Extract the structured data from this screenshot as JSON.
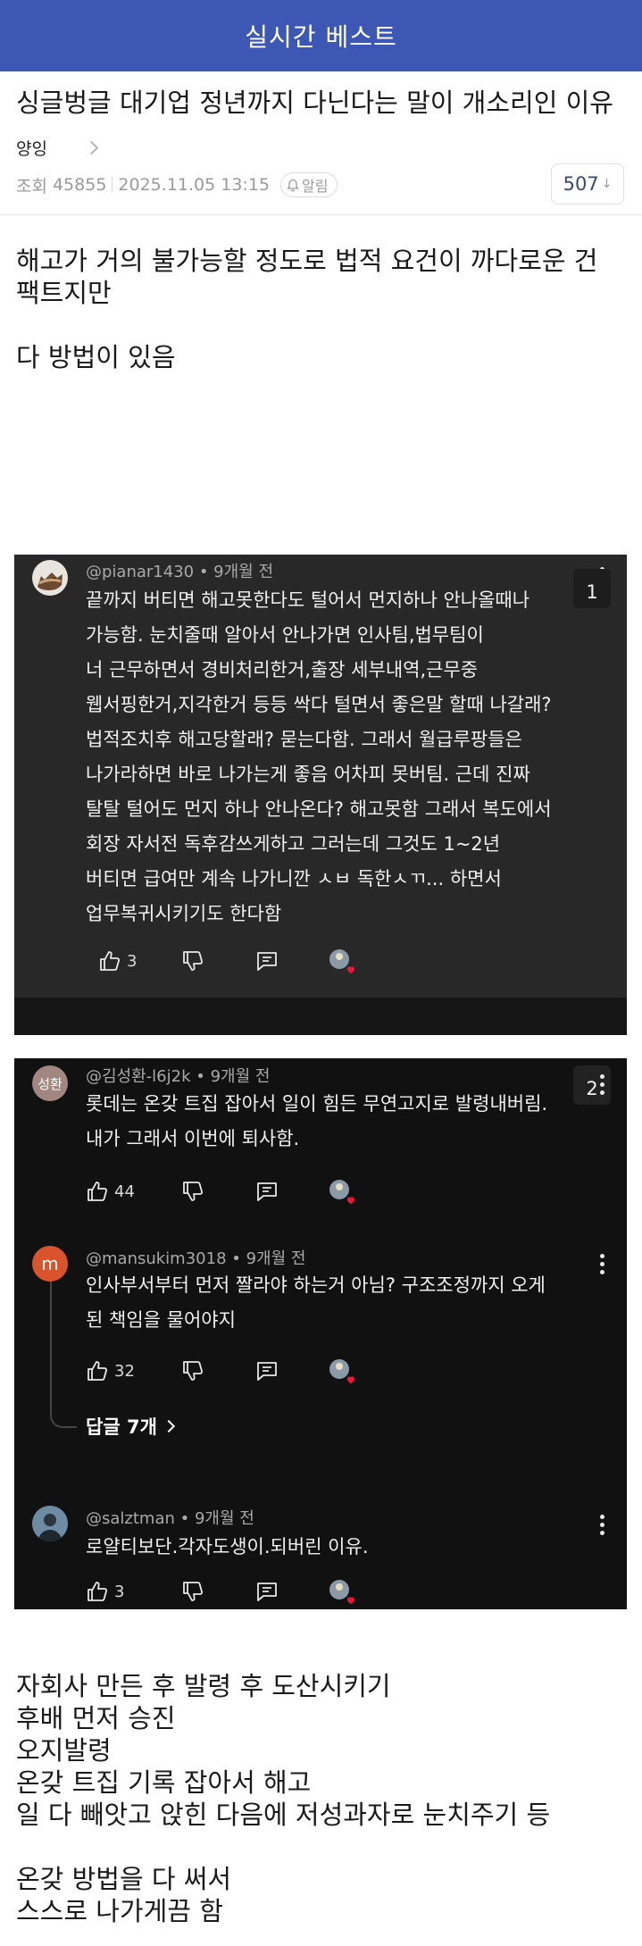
{
  "header": {
    "title": "실시간 베스트"
  },
  "post": {
    "title": "싱글벙글 대기업 정년까지 다닌다는 말이 개소리인 이유",
    "author": "양잉",
    "views_label": "조회",
    "views": "45855",
    "datetime": "2025.11.05 13:15",
    "alarm_label": "알림",
    "comment_count": "507",
    "comment_arrow": "↓",
    "intro_line1": "해고가 거의 불가능할 정도로 법적 요건이 까다로운 건",
    "intro_line2": "팩트지만",
    "intro_line3": "다 방법이 있음",
    "outro_lines": [
      "자회사 만든 후 발령 후 도산시키기",
      "후배 먼저 승진",
      "오지발령",
      "온갖 트집 기록 잡아서 해고",
      "일 다 빼앗고 앉힌 다음에 저성과자로 눈치주기 등"
    ],
    "outro_final1": "온갖 방법을 다 써서",
    "outro_final2": "스스로 나가게끔 함"
  },
  "comment_cards": [
    {
      "rank": "1",
      "comments": [
        {
          "handle": "@pianar1430 • 9개월 전",
          "lines": [
            "끝까지 버티면 해고못한다도 털어서 먼지하나 안나올때나",
            "가능함. 눈치줄때 알아서 안나가면 인사팀,법무팀이",
            "너 근무하면서 경비처리한거,출장 세부내역,근무중",
            "웹서핑한거,지각한거 등등 싹다 털면서 좋은말 할때 나갈래?",
            "법적조치후 해고당할래? 묻는다함. 그래서 월급루팡들은",
            "나가라하면 바로 나가는게 좋음 어차피 못버팀. 근데 진짜",
            "탈탈 털어도 먼지 하나 안나온다? 해고못함 그래서 복도에서",
            "회장 자서전 독후감쓰게하고 그러는데 그것도 1~2년",
            "버티면 급여만 계속 나가니깐 ㅅㅂ 독한ㅅㄲ... 하면서",
            "업무복귀시키기도 한다함"
          ],
          "likes": "3",
          "avatar_icon": "cat-avatar-icon"
        }
      ]
    },
    {
      "rank": "2",
      "comments": [
        {
          "handle": "@김성환-l6j2k • 9개월 전",
          "avatar_text": "성환",
          "lines": [
            "롯데는 온갖 트집 잡아서 일이 힘든 무연고지로 발령내버림.",
            "내가 그래서 이번에 퇴사함."
          ],
          "likes": "44"
        },
        {
          "handle": "@mansukim3018 • 9개월 전",
          "avatar_text": "m",
          "lines": [
            "인사부서부터 먼저 짤라야 하는거 아님? 구조조정까지 오게",
            "된 책임을 물어야지"
          ],
          "likes": "32",
          "replies_label": "답글 7개"
        },
        {
          "handle": "@salztman • 9개월 전",
          "lines": [
            "로얄티보단.각자도생이.되버린 이유."
          ],
          "likes": "3",
          "avatar_icon": "profile-photo-icon"
        }
      ]
    }
  ],
  "colors": {
    "header_bg": "#3d58b4",
    "card1_bg": "#282828",
    "card2_bg": "#111111",
    "avatar_m": "#d9532c",
    "avatar_sunghwan": "#a1877f",
    "heart": "#e8173d"
  }
}
